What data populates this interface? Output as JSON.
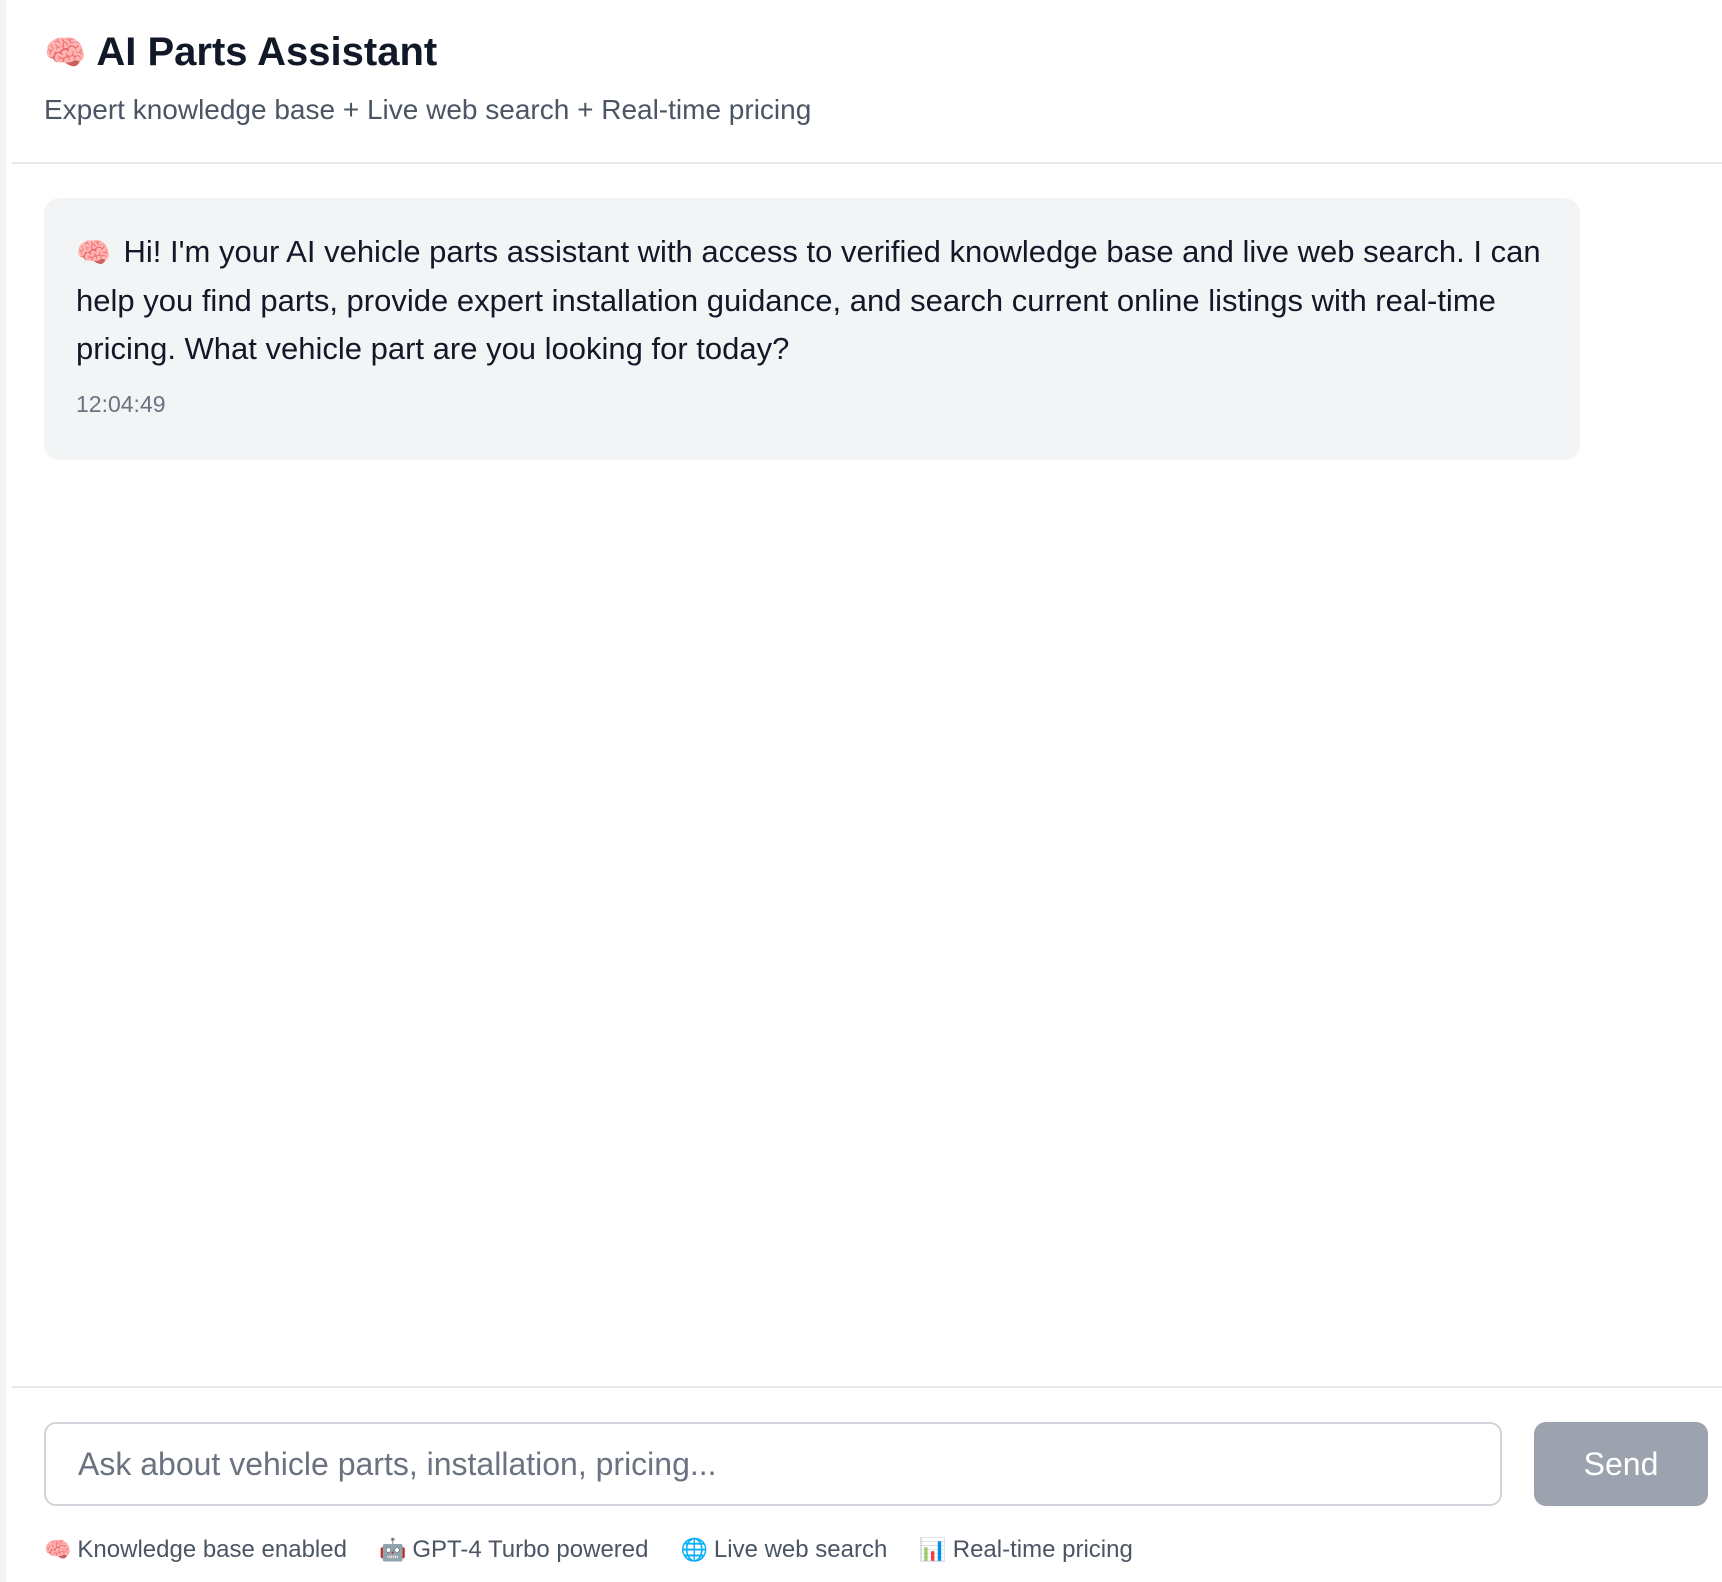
{
  "header": {
    "icon": "brain-icon",
    "title": "AI Parts Assistant",
    "subtitle": "Expert knowledge base + Live web search + Real-time pricing"
  },
  "messages": [
    {
      "icon": "brain-icon",
      "text": "Hi! I'm your AI vehicle parts assistant with access to verified knowledge base and live web search. I can help you find parts, provide expert installation guidance, and search current online listings with real-time pricing. What vehicle part are you looking for today?",
      "timestamp": "12:04:49"
    }
  ],
  "composer": {
    "placeholder": "Ask about vehicle parts, installation, pricing...",
    "value": "",
    "send_label": "Send",
    "send_color": "#9ca3af"
  },
  "features": [
    {
      "icon": "brain-icon",
      "label": "Knowledge base enabled"
    },
    {
      "icon": "robot-icon",
      "label": "GPT-4 Turbo powered"
    },
    {
      "icon": "globe-icon",
      "label": "Live web search"
    },
    {
      "icon": "bar-chart-icon",
      "label": "Real-time pricing"
    }
  ]
}
